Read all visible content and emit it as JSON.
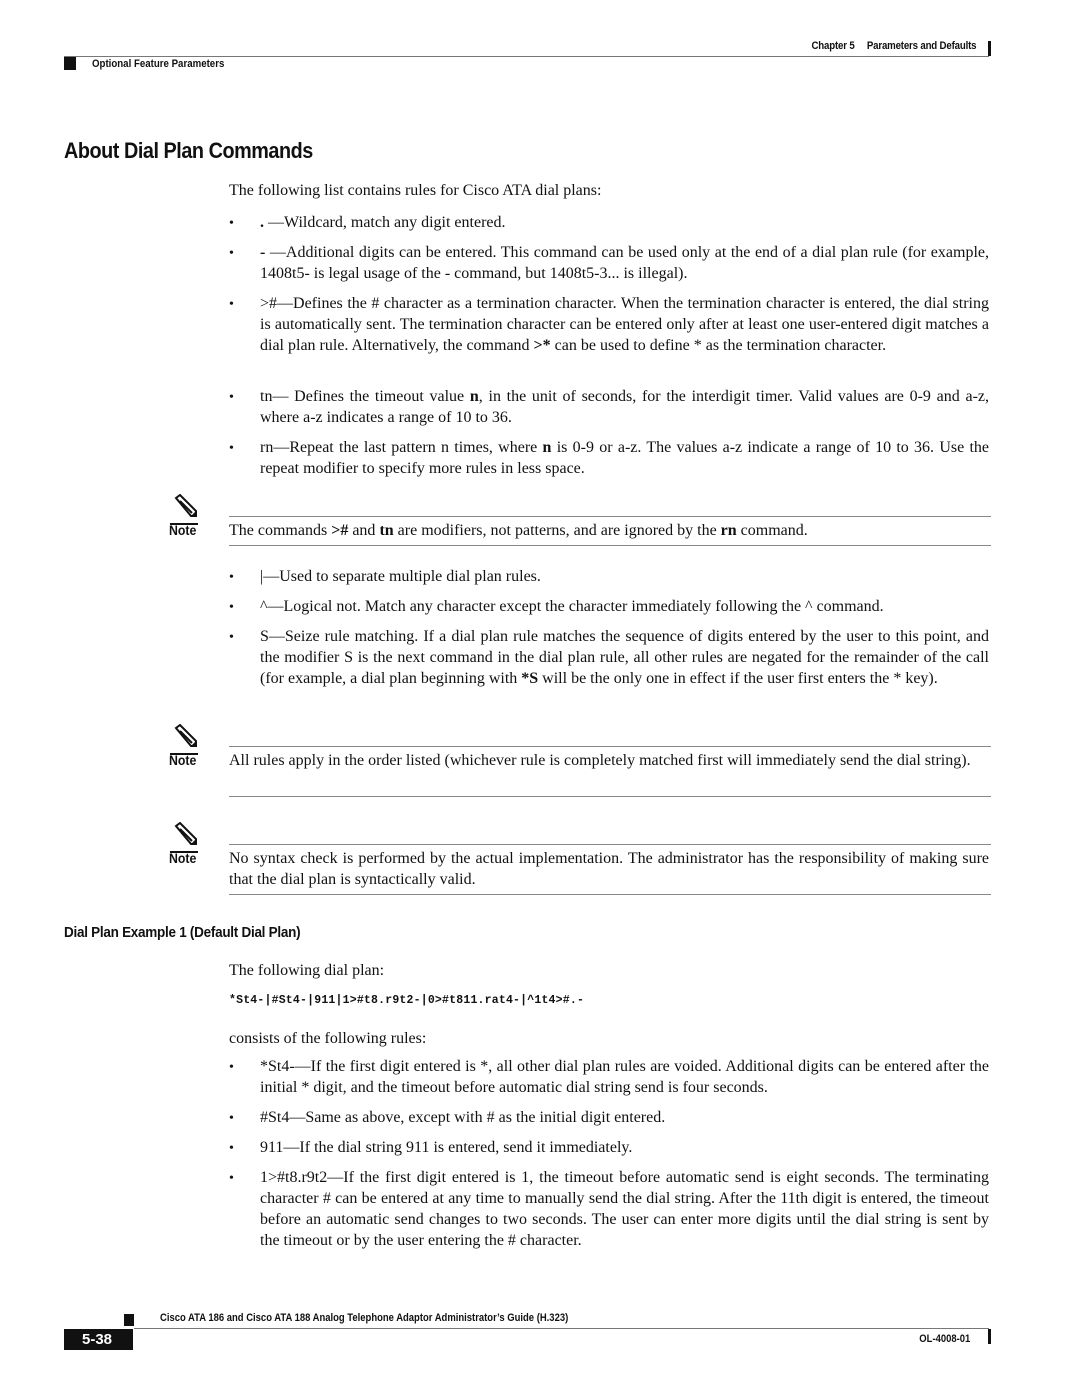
{
  "header": {
    "chapter": "Chapter 5",
    "chapter_title": "Parameters and Defaults",
    "section": "Optional Feature Parameters"
  },
  "title": "About Dial Plan Commands",
  "intro": "The following list contains rules for Cisco ATA dial plans:",
  "rules_part1": [
    {
      "cmd": ".",
      "html": "<b>.</b> —Wildcard, match any digit entered."
    },
    {
      "cmd": "-",
      "html": "<b>-</b> —Additional digits can be entered. This command can be used only at the end of a dial plan rule (for example, 1408t5- is legal usage of the - command, but 1408t5-3... is illegal)."
    },
    {
      "cmd": ">#",
      "html": ">#—Defines the # character as a termination character. When the termination character is entered, the dial string is automatically sent. The termination character can be entered only after at least one user-entered digit matches a dial plan rule. Alternatively, the command <b>&gt;*</b> can be used to define * as the termination character."
    },
    {
      "cmd": "tn",
      "html": "tn— Defines the timeout value <b>n</b>, in the unit of seconds, for the interdigit timer. Valid values are 0-9 and a-z, where a-z indicates a range of 10 to 36."
    },
    {
      "cmd": "rn",
      "html": "rn—Repeat the last pattern n times, where <b>n</b> is 0-9 or a-z. The values a-z indicate a range of 10 to 36. Use the repeat modifier to specify more rules in less space."
    }
  ],
  "note1": {
    "label": "Note",
    "html": "The commands <b>&gt;#</b> and <b>tn</b> are modifiers, not patterns, and are ignored by the <b>rn</b> command."
  },
  "rules_part2": [
    {
      "cmd": "|",
      "html": "|—Used to separate multiple dial plan rules."
    },
    {
      "cmd": "^",
      "html": "^—Logical not. Match any character except the character immediately following the ^ command."
    },
    {
      "cmd": "S",
      "html": "S—Seize rule matching. If a dial plan rule matches the sequence of digits entered by the user to this point, and the modifier S is the next command in the dial plan rule, all other rules are negated for the remainder of the call (for example, a dial plan beginning with <b>*S</b> will be the only one in effect if the user first enters the * key)."
    }
  ],
  "note2": {
    "label": "Note",
    "text": "All rules apply in the order listed (whichever rule is completely matched first will immediately send the dial string)."
  },
  "note3": {
    "label": "Note",
    "text": "No syntax check is performed by the actual implementation. The administrator has the responsibility of making sure that the dial plan is syntactically valid."
  },
  "example": {
    "heading": "Dial Plan Example 1 (Default Dial Plan)",
    "lead": "The following dial plan:",
    "dial_plan": "*St4-|#St4-|911|1>#t8.r9t2-|0>#t811.rat4-|^1t4>#.-",
    "consists": "consists of the following rules:",
    "rules": [
      {
        "cmd": "*St4-",
        "text": "*St4-—If the first digit entered is *, all other dial plan rules are voided. Additional digits can be entered after the initial * digit, and the timeout before automatic dial string send is four seconds."
      },
      {
        "cmd": "#St4",
        "text": "#St4—Same as above, except with # as the initial digit entered."
      },
      {
        "cmd": "911",
        "text": "911—If the dial string 911 is entered, send it immediately."
      },
      {
        "cmd": "1>#t8.r9t2",
        "text": "1>#t8.r9t2—If the first digit entered is 1, the timeout before automatic send is eight seconds. The terminating character # can be entered at any time to manually send the dial string. After the 11th digit is entered, the timeout before an automatic send changes to two seconds. The user can enter more digits until the dial string is sent by the timeout or by the user entering the # character."
      }
    ]
  },
  "footer": {
    "guide_title": "Cisco ATA 186 and Cisco ATA 188 Analog Telephone Adaptor Administrator’s Guide (H.323)",
    "page_number": "5-38",
    "doc_id": "OL-4008-01"
  },
  "icons": {
    "note": "pencil-note-icon"
  }
}
